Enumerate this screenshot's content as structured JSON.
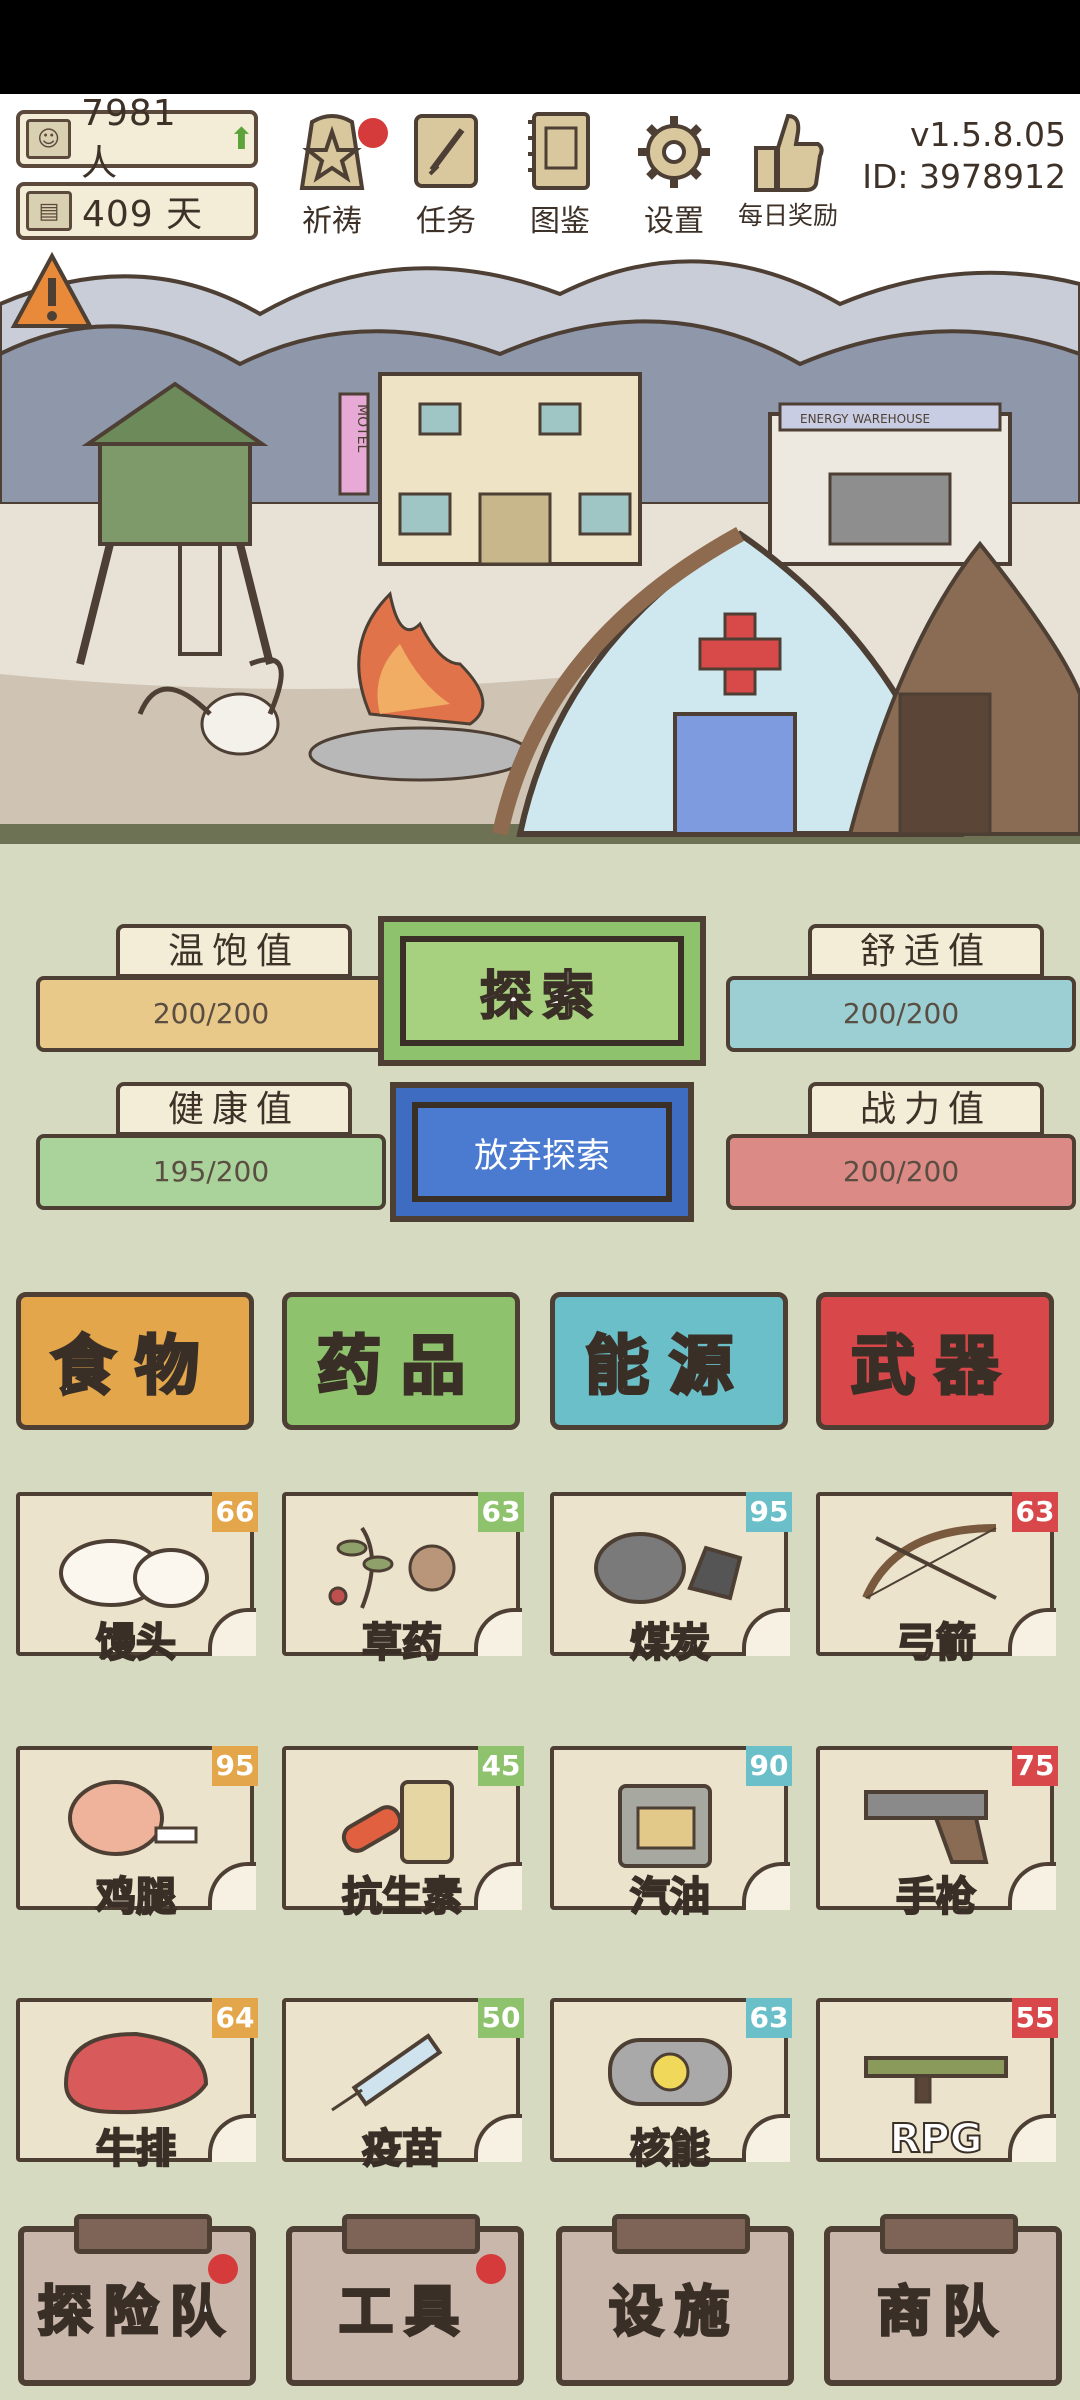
{
  "header": {
    "population": "7981 人",
    "days": "409 天",
    "version": "v1.5.8.05",
    "player_id": "ID: 3978912"
  },
  "nav": [
    {
      "label": "祈祷",
      "icon": "pray-star-icon",
      "has_dot": true
    },
    {
      "label": "任务",
      "icon": "quest-scroll-icon",
      "has_dot": false
    },
    {
      "label": "图鉴",
      "icon": "book-icon",
      "has_dot": false
    },
    {
      "label": "设置",
      "icon": "gear-icon",
      "has_dot": false
    },
    {
      "label": "每日奖励",
      "icon": "thumbs-up-icon",
      "has_dot": false
    }
  ],
  "scene": {
    "motel_sign": "MOTEL",
    "warehouse_sign": "ENERGY WAREHOUSE"
  },
  "meters": {
    "satiety": {
      "label": "温饱值",
      "value": "200/200",
      "color": "#e8c98a"
    },
    "comfort": {
      "label": "舒适值",
      "value": "200/200",
      "color": "#9bcfd3"
    },
    "health": {
      "label": "健康值",
      "value": "195/200",
      "color": "#a9d39b"
    },
    "power": {
      "label": "战力值",
      "value": "200/200",
      "color": "#dc8a86"
    }
  },
  "actions": {
    "explore": "探索",
    "abandon": "放弃探索"
  },
  "categories": [
    {
      "label": "食物",
      "color": "#e4a64b"
    },
    {
      "label": "药品",
      "color": "#8fc26c"
    },
    {
      "label": "能源",
      "color": "#6bbfc8"
    },
    {
      "label": "武器",
      "color": "#d8474a"
    }
  ],
  "items": [
    {
      "name": "馒头",
      "count": "66",
      "icon": "steamed-bun-icon",
      "badge": "#e4a64b"
    },
    {
      "name": "草药",
      "count": "63",
      "icon": "herb-icon",
      "badge": "#8fc26c"
    },
    {
      "name": "煤炭",
      "count": "95",
      "icon": "coal-icon",
      "badge": "#6bbfc8"
    },
    {
      "name": "弓箭",
      "count": "63",
      "icon": "bow-arrow-icon",
      "badge": "#d8474a"
    },
    {
      "name": "鸡腿",
      "count": "95",
      "icon": "drumstick-icon",
      "badge": "#e4a64b"
    },
    {
      "name": "抗生素",
      "count": "45",
      "icon": "antibiotic-icon",
      "badge": "#8fc26c"
    },
    {
      "name": "汽油",
      "count": "90",
      "icon": "gas-can-icon",
      "badge": "#6bbfc8"
    },
    {
      "name": "手枪",
      "count": "75",
      "icon": "pistol-icon",
      "badge": "#d8474a"
    },
    {
      "name": "牛排",
      "count": "64",
      "icon": "steak-icon",
      "badge": "#e4a64b"
    },
    {
      "name": "疫苗",
      "count": "50",
      "icon": "syringe-icon",
      "badge": "#8fc26c"
    },
    {
      "name": "核能",
      "count": "63",
      "icon": "nuclear-canister-icon",
      "badge": "#6bbfc8"
    },
    {
      "name": "RPG",
      "count": "55",
      "icon": "rpg-launcher-icon",
      "badge": "#d8474a"
    }
  ],
  "bottom_tabs": [
    {
      "label": "探险队",
      "has_dot": true
    },
    {
      "label": "工具",
      "has_dot": true
    },
    {
      "label": "设施",
      "has_dot": false
    },
    {
      "label": "商队",
      "has_dot": false
    }
  ]
}
